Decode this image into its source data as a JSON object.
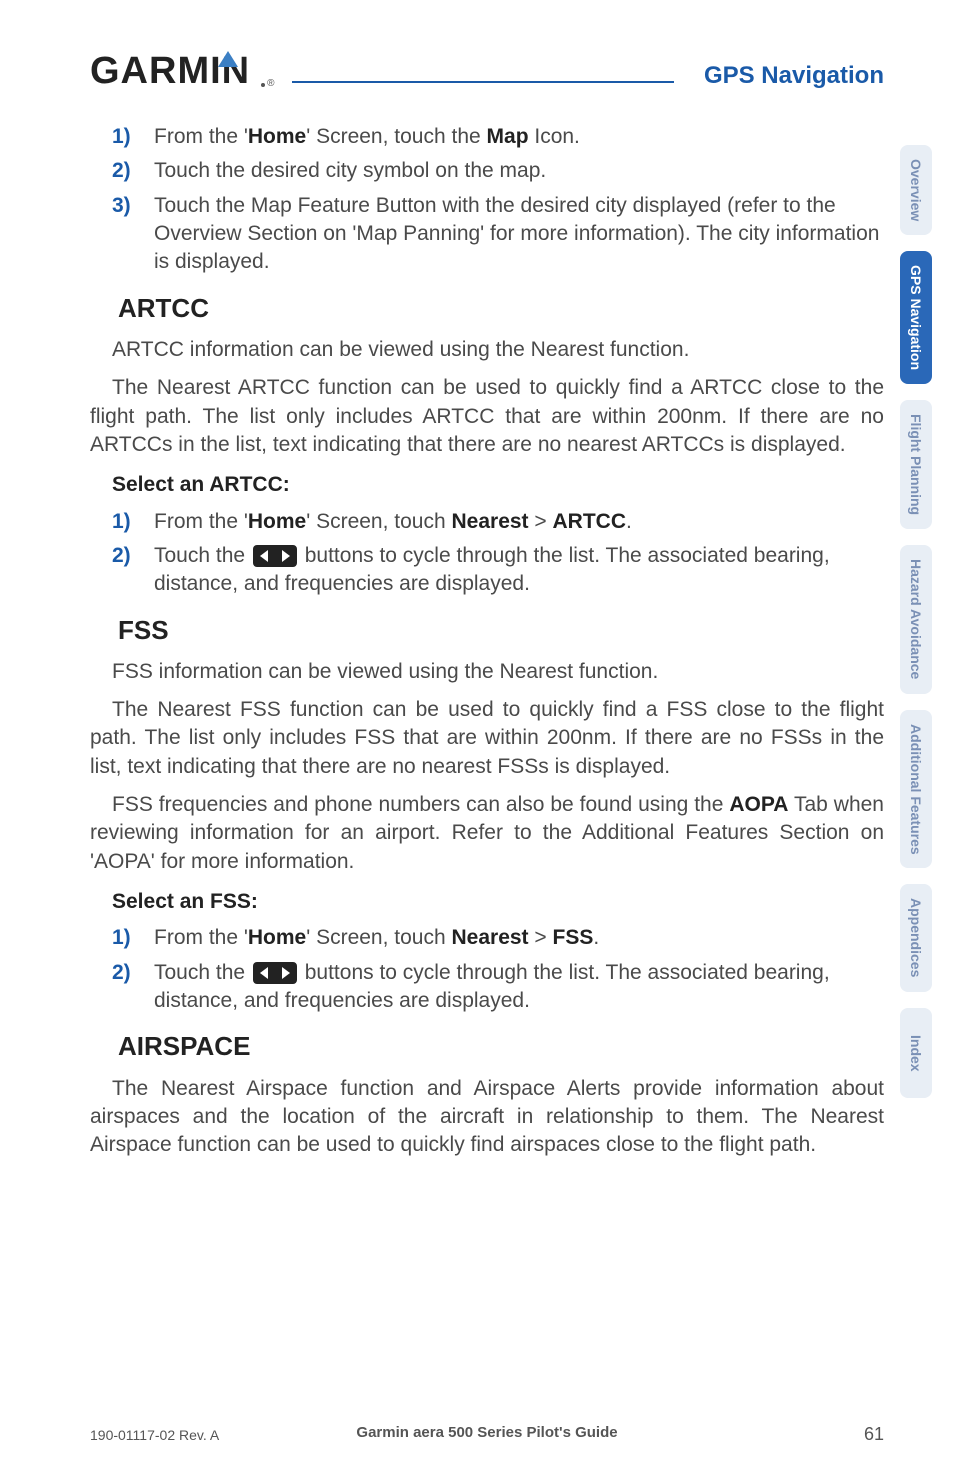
{
  "header": {
    "logo_text": "GARMIN",
    "section_title": "GPS Navigation"
  },
  "tabs": [
    {
      "label": "Overview",
      "active": false
    },
    {
      "label": "GPS Navigation",
      "active": true
    },
    {
      "label": "Flight Planning",
      "active": false
    },
    {
      "label": "Hazard Avoidance",
      "active": false
    },
    {
      "label": "Additional Features",
      "active": false
    },
    {
      "label": "Appendices",
      "active": false
    },
    {
      "label": "Index",
      "active": false
    }
  ],
  "steps_top": [
    {
      "num": "1)",
      "text_pre": "From the '",
      "bold1": "Home",
      "mid1": "' Screen, touch the ",
      "bold2": "Map",
      "mid2": " Icon."
    },
    {
      "num": "2)",
      "text": "Touch the desired city symbol on the map."
    },
    {
      "num": "3)",
      "text": "Touch the Map Feature Button with the desired city displayed (refer to the Overview Section on 'Map Panning' for more information).  The city information is displayed."
    }
  ],
  "artcc": {
    "heading": "ARTCC",
    "p1": "ARTCC information can be viewed using the Nearest function.",
    "p2": "The Nearest ARTCC function can be used to quickly find a ARTCC close to the flight path.  The list only includes ARTCC that are within 200nm.  If there are no ARTCCs in the list, text indicating that there are no nearest ARTCCs is displayed.",
    "select_heading": "Select an ARTCC:",
    "step1": {
      "num": "1)",
      "pre": "From the '",
      "bold1": "Home",
      "mid1": "' Screen, touch ",
      "bold2": "Nearest",
      "mid2": " > ",
      "bold3": "ARTCC",
      "post": "."
    },
    "step2": {
      "num": "2)",
      "pre": "Touch the ",
      "post": " buttons to cycle through the list.  The associated bearing, distance, and frequencies are displayed."
    }
  },
  "fss": {
    "heading": "FSS",
    "p1": "FSS information can be viewed using the Nearest function.",
    "p2": "The Nearest FSS function can be used to quickly find a FSS close to the flight path.  The list only includes FSS that are within 200nm.  If there are no FSSs in the list, text indicating that there are no nearest FSSs is displayed.",
    "p3_pre": "FSS frequencies and phone numbers can also be found using the ",
    "p3_bold": "AOPA",
    "p3_post": " Tab when reviewing information for an airport.  Refer to the Additional Features Section on 'AOPA' for more information.",
    "select_heading": "Select an FSS:",
    "step1": {
      "num": "1)",
      "pre": "From the '",
      "bold1": "Home",
      "mid1": "' Screen, touch ",
      "bold2": "Nearest",
      "mid2": " > ",
      "bold3": "FSS",
      "post": "."
    },
    "step2": {
      "num": "2)",
      "pre": "Touch the ",
      "post": " buttons to cycle through the list.  The associated bearing, distance, and frequencies are displayed."
    }
  },
  "airspace": {
    "heading": "AIRSPACE",
    "p1": "The Nearest Airspace function and Airspace Alerts provide information about airspaces and the location of the aircraft in relationship to them.  The Nearest Airspace function can be used to quickly find airspaces close to the flight path."
  },
  "footer": {
    "left": "190-01117-02 Rev. A",
    "center": "Garmin aera 500 Series Pilot's Guide",
    "right": "61"
  }
}
